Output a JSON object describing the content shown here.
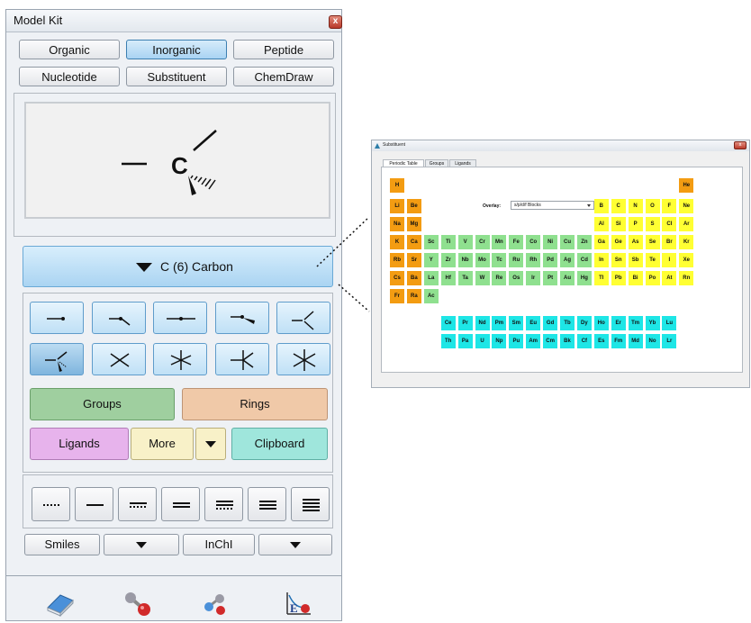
{
  "model_kit": {
    "title": "Model Kit",
    "close_glyph": "x",
    "tabs": [
      {
        "label": "Organic",
        "active": false
      },
      {
        "label": "Inorganic",
        "active": true
      },
      {
        "label": "Peptide",
        "active": false
      },
      {
        "label": "Nucleotide",
        "active": false
      },
      {
        "label": "Substituent",
        "active": false
      },
      {
        "label": "ChemDraw",
        "active": false
      }
    ],
    "preview": {
      "atom_label": "C"
    },
    "element_selector": {
      "label": "C (6) Carbon"
    },
    "geometry_buttons": [
      {
        "name": "geometry-1-bond",
        "selected": false
      },
      {
        "name": "geometry-2-bond-bent",
        "selected": false
      },
      {
        "name": "geometry-2-bond-linear",
        "selected": false
      },
      {
        "name": "geometry-3-bond-planar",
        "selected": false
      },
      {
        "name": "geometry-3-bond",
        "selected": false
      },
      {
        "name": "geometry-tetrahedral",
        "selected": true
      },
      {
        "name": "geometry-square-planar",
        "selected": false
      },
      {
        "name": "geometry-trigonal-bipyramidal",
        "selected": false
      },
      {
        "name": "geometry-seesaw",
        "selected": false
      },
      {
        "name": "geometry-octahedral",
        "selected": false
      }
    ],
    "groups_label": "Groups",
    "rings_label": "Rings",
    "ligands_label": "Ligands",
    "more_label": "More",
    "clipboard_label": "Clipboard",
    "bond_types": [
      "dotted-bond",
      "single-bond",
      "partial-double-bond",
      "double-bond",
      "partial-triple-bond",
      "triple-bond",
      "quadruple-bond"
    ],
    "smiles_label": "Smiles",
    "inchi_label": "InChI",
    "tools": [
      "eraser-icon",
      "bond-tool-icon",
      "fragment-tool-icon",
      "energy-minimize-icon"
    ],
    "colors": {
      "groups": "#9fcf9f",
      "rings": "#f0c9a8",
      "ligands": "#e7b3ec",
      "more": "#f8f1c8",
      "clipboard": "#9fe6dc",
      "accent": "#a9d3f3"
    }
  },
  "substituent": {
    "title": "Substituent",
    "close_glyph": "x",
    "tabs": [
      {
        "label": "Periodic Table",
        "active": true
      },
      {
        "label": "Groups",
        "active": false
      },
      {
        "label": "Ligands",
        "active": false
      }
    ],
    "overlay_label": "Overlay:",
    "overlay_value": "s/p/d/f Blocks",
    "block_colors": {
      "s": "#f39c12",
      "p": "#ffff33",
      "d": "#8fe08f",
      "f": "#1ee6e6"
    },
    "elements": [
      {
        "sym": "H",
        "row": 1,
        "col": 1,
        "block": "s"
      },
      {
        "sym": "He",
        "row": 1,
        "col": 18,
        "block": "s"
      },
      {
        "sym": "Li",
        "row": 2,
        "col": 1,
        "block": "s"
      },
      {
        "sym": "Be",
        "row": 2,
        "col": 2,
        "block": "s"
      },
      {
        "sym": "B",
        "row": 2,
        "col": 13,
        "block": "p"
      },
      {
        "sym": "C",
        "row": 2,
        "col": 14,
        "block": "p"
      },
      {
        "sym": "N",
        "row": 2,
        "col": 15,
        "block": "p"
      },
      {
        "sym": "O",
        "row": 2,
        "col": 16,
        "block": "p"
      },
      {
        "sym": "F",
        "row": 2,
        "col": 17,
        "block": "p"
      },
      {
        "sym": "Ne",
        "row": 2,
        "col": 18,
        "block": "p"
      },
      {
        "sym": "Na",
        "row": 3,
        "col": 1,
        "block": "s"
      },
      {
        "sym": "Mg",
        "row": 3,
        "col": 2,
        "block": "s"
      },
      {
        "sym": "Al",
        "row": 3,
        "col": 13,
        "block": "p"
      },
      {
        "sym": "Si",
        "row": 3,
        "col": 14,
        "block": "p"
      },
      {
        "sym": "P",
        "row": 3,
        "col": 15,
        "block": "p"
      },
      {
        "sym": "S",
        "row": 3,
        "col": 16,
        "block": "p"
      },
      {
        "sym": "Cl",
        "row": 3,
        "col": 17,
        "block": "p"
      },
      {
        "sym": "Ar",
        "row": 3,
        "col": 18,
        "block": "p"
      },
      {
        "sym": "K",
        "row": 4,
        "col": 1,
        "block": "s"
      },
      {
        "sym": "Ca",
        "row": 4,
        "col": 2,
        "block": "s"
      },
      {
        "sym": "Sc",
        "row": 4,
        "col": 3,
        "block": "d"
      },
      {
        "sym": "Ti",
        "row": 4,
        "col": 4,
        "block": "d"
      },
      {
        "sym": "V",
        "row": 4,
        "col": 5,
        "block": "d"
      },
      {
        "sym": "Cr",
        "row": 4,
        "col": 6,
        "block": "d"
      },
      {
        "sym": "Mn",
        "row": 4,
        "col": 7,
        "block": "d"
      },
      {
        "sym": "Fe",
        "row": 4,
        "col": 8,
        "block": "d"
      },
      {
        "sym": "Co",
        "row": 4,
        "col": 9,
        "block": "d"
      },
      {
        "sym": "Ni",
        "row": 4,
        "col": 10,
        "block": "d"
      },
      {
        "sym": "Cu",
        "row": 4,
        "col": 11,
        "block": "d"
      },
      {
        "sym": "Zn",
        "row": 4,
        "col": 12,
        "block": "d"
      },
      {
        "sym": "Ga",
        "row": 4,
        "col": 13,
        "block": "p"
      },
      {
        "sym": "Ge",
        "row": 4,
        "col": 14,
        "block": "p"
      },
      {
        "sym": "As",
        "row": 4,
        "col": 15,
        "block": "p"
      },
      {
        "sym": "Se",
        "row": 4,
        "col": 16,
        "block": "p"
      },
      {
        "sym": "Br",
        "row": 4,
        "col": 17,
        "block": "p"
      },
      {
        "sym": "Kr",
        "row": 4,
        "col": 18,
        "block": "p"
      },
      {
        "sym": "Rb",
        "row": 5,
        "col": 1,
        "block": "s"
      },
      {
        "sym": "Sr",
        "row": 5,
        "col": 2,
        "block": "s"
      },
      {
        "sym": "Y",
        "row": 5,
        "col": 3,
        "block": "d"
      },
      {
        "sym": "Zr",
        "row": 5,
        "col": 4,
        "block": "d"
      },
      {
        "sym": "Nb",
        "row": 5,
        "col": 5,
        "block": "d"
      },
      {
        "sym": "Mo",
        "row": 5,
        "col": 6,
        "block": "d"
      },
      {
        "sym": "Tc",
        "row": 5,
        "col": 7,
        "block": "d"
      },
      {
        "sym": "Ru",
        "row": 5,
        "col": 8,
        "block": "d"
      },
      {
        "sym": "Rh",
        "row": 5,
        "col": 9,
        "block": "d"
      },
      {
        "sym": "Pd",
        "row": 5,
        "col": 10,
        "block": "d"
      },
      {
        "sym": "Ag",
        "row": 5,
        "col": 11,
        "block": "d"
      },
      {
        "sym": "Cd",
        "row": 5,
        "col": 12,
        "block": "d"
      },
      {
        "sym": "In",
        "row": 5,
        "col": 13,
        "block": "p"
      },
      {
        "sym": "Sn",
        "row": 5,
        "col": 14,
        "block": "p"
      },
      {
        "sym": "Sb",
        "row": 5,
        "col": 15,
        "block": "p"
      },
      {
        "sym": "Te",
        "row": 5,
        "col": 16,
        "block": "p"
      },
      {
        "sym": "I",
        "row": 5,
        "col": 17,
        "block": "p"
      },
      {
        "sym": "Xe",
        "row": 5,
        "col": 18,
        "block": "p"
      },
      {
        "sym": "Cs",
        "row": 6,
        "col": 1,
        "block": "s"
      },
      {
        "sym": "Ba",
        "row": 6,
        "col": 2,
        "block": "s"
      },
      {
        "sym": "La",
        "row": 6,
        "col": 3,
        "block": "d"
      },
      {
        "sym": "Hf",
        "row": 6,
        "col": 4,
        "block": "d"
      },
      {
        "sym": "Ta",
        "row": 6,
        "col": 5,
        "block": "d"
      },
      {
        "sym": "W",
        "row": 6,
        "col": 6,
        "block": "d"
      },
      {
        "sym": "Re",
        "row": 6,
        "col": 7,
        "block": "d"
      },
      {
        "sym": "Os",
        "row": 6,
        "col": 8,
        "block": "d"
      },
      {
        "sym": "Ir",
        "row": 6,
        "col": 9,
        "block": "d"
      },
      {
        "sym": "Pt",
        "row": 6,
        "col": 10,
        "block": "d"
      },
      {
        "sym": "Au",
        "row": 6,
        "col": 11,
        "block": "d"
      },
      {
        "sym": "Hg",
        "row": 6,
        "col": 12,
        "block": "d"
      },
      {
        "sym": "Tl",
        "row": 6,
        "col": 13,
        "block": "p"
      },
      {
        "sym": "Pb",
        "row": 6,
        "col": 14,
        "block": "p"
      },
      {
        "sym": "Bi",
        "row": 6,
        "col": 15,
        "block": "p"
      },
      {
        "sym": "Po",
        "row": 6,
        "col": 16,
        "block": "p"
      },
      {
        "sym": "At",
        "row": 6,
        "col": 17,
        "block": "p"
      },
      {
        "sym": "Rn",
        "row": 6,
        "col": 18,
        "block": "p"
      },
      {
        "sym": "Fr",
        "row": 7,
        "col": 1,
        "block": "s"
      },
      {
        "sym": "Ra",
        "row": 7,
        "col": 2,
        "block": "s"
      },
      {
        "sym": "Ac",
        "row": 7,
        "col": 3,
        "block": "d"
      },
      {
        "sym": "Ce",
        "row": 9,
        "col": 4,
        "block": "f"
      },
      {
        "sym": "Pr",
        "row": 9,
        "col": 5,
        "block": "f"
      },
      {
        "sym": "Nd",
        "row": 9,
        "col": 6,
        "block": "f"
      },
      {
        "sym": "Pm",
        "row": 9,
        "col": 7,
        "block": "f"
      },
      {
        "sym": "Sm",
        "row": 9,
        "col": 8,
        "block": "f"
      },
      {
        "sym": "Eu",
        "row": 9,
        "col": 9,
        "block": "f"
      },
      {
        "sym": "Gd",
        "row": 9,
        "col": 10,
        "block": "f"
      },
      {
        "sym": "Tb",
        "row": 9,
        "col": 11,
        "block": "f"
      },
      {
        "sym": "Dy",
        "row": 9,
        "col": 12,
        "block": "f"
      },
      {
        "sym": "Ho",
        "row": 9,
        "col": 13,
        "block": "f"
      },
      {
        "sym": "Er",
        "row": 9,
        "col": 14,
        "block": "f"
      },
      {
        "sym": "Tm",
        "row": 9,
        "col": 15,
        "block": "f"
      },
      {
        "sym": "Yb",
        "row": 9,
        "col": 16,
        "block": "f"
      },
      {
        "sym": "Lu",
        "row": 9,
        "col": 17,
        "block": "f"
      },
      {
        "sym": "Th",
        "row": 10,
        "col": 4,
        "block": "f"
      },
      {
        "sym": "Pa",
        "row": 10,
        "col": 5,
        "block": "f"
      },
      {
        "sym": "U",
        "row": 10,
        "col": 6,
        "block": "f"
      },
      {
        "sym": "Np",
        "row": 10,
        "col": 7,
        "block": "f"
      },
      {
        "sym": "Pu",
        "row": 10,
        "col": 8,
        "block": "f"
      },
      {
        "sym": "Am",
        "row": 10,
        "col": 9,
        "block": "f"
      },
      {
        "sym": "Cm",
        "row": 10,
        "col": 10,
        "block": "f"
      },
      {
        "sym": "Bk",
        "row": 10,
        "col": 11,
        "block": "f"
      },
      {
        "sym": "Cf",
        "row": 10,
        "col": 12,
        "block": "f"
      },
      {
        "sym": "Es",
        "row": 10,
        "col": 13,
        "block": "f"
      },
      {
        "sym": "Fm",
        "row": 10,
        "col": 14,
        "block": "f"
      },
      {
        "sym": "Md",
        "row": 10,
        "col": 15,
        "block": "f"
      },
      {
        "sym": "No",
        "row": 10,
        "col": 16,
        "block": "f"
      },
      {
        "sym": "Lr",
        "row": 10,
        "col": 17,
        "block": "f"
      }
    ]
  }
}
